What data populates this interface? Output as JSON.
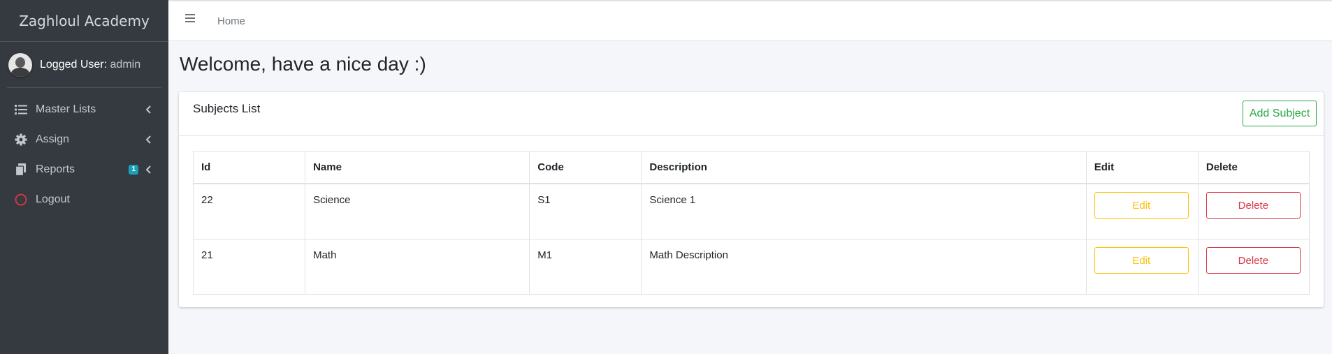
{
  "sidebar": {
    "brand": "Zaghloul Academy",
    "user_label": "Logged User:",
    "user_name": "admin",
    "items": [
      {
        "label": "Master Lists",
        "icon": "list-icon"
      },
      {
        "label": "Assign",
        "icon": "gear-icon"
      },
      {
        "label": "Reports",
        "icon": "copy-icon",
        "badge": "1"
      },
      {
        "label": "Logout",
        "icon": "power-circle-icon"
      }
    ]
  },
  "navbar": {
    "breadcrumb": "Home"
  },
  "main": {
    "title": "Welcome, have a nice day :)",
    "card_title": "Subjects List",
    "add_button": "Add Subject",
    "columns": [
      "Id",
      "Name",
      "Code",
      "Description",
      "Edit",
      "Delete"
    ],
    "rows": [
      {
        "id": "22",
        "name": "Science",
        "code": "S1",
        "description": "Science 1",
        "edit": "Edit",
        "delete": "Delete"
      },
      {
        "id": "21",
        "name": "Math",
        "code": "M1",
        "description": "Math Description",
        "edit": "Edit",
        "delete": "Delete"
      }
    ]
  },
  "colors": {
    "sidebar_bg": "#343a40",
    "success": "#28a745",
    "warning": "#ffc107",
    "danger": "#dc3545",
    "info_badge": "#17a2b8"
  }
}
